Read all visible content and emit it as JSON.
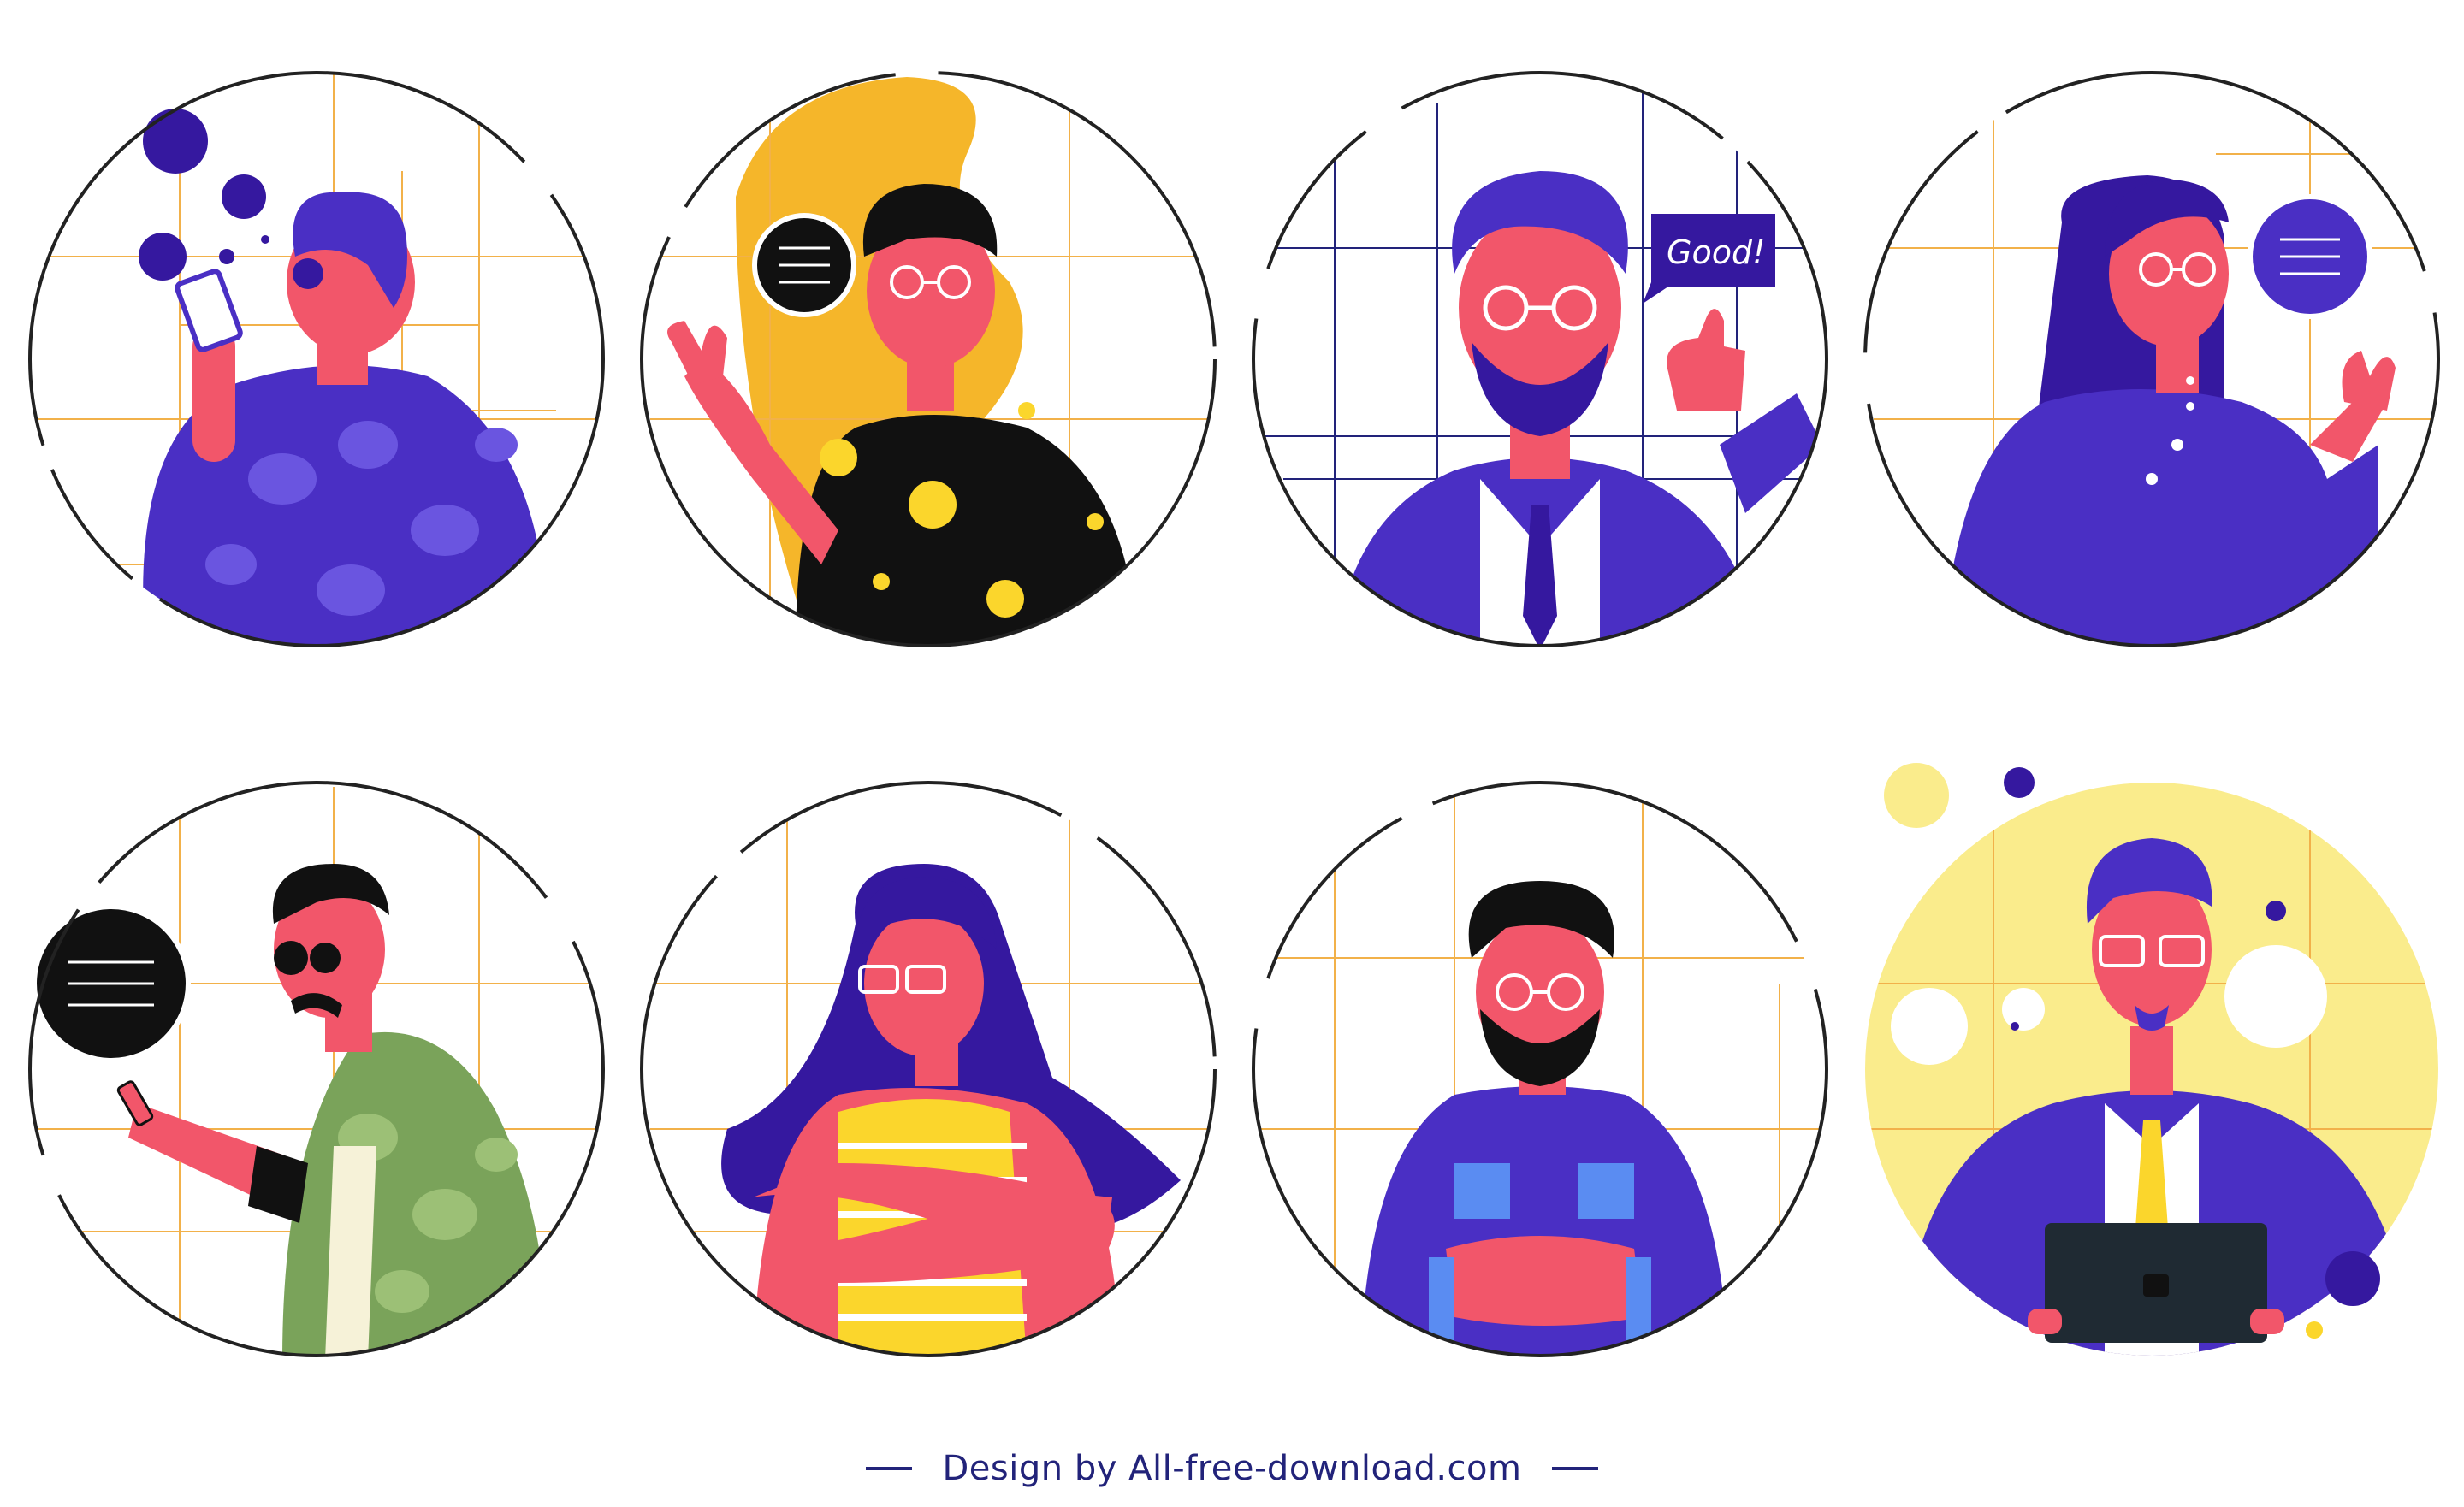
{
  "footer": {
    "credit": "Design by All-free-download.com"
  },
  "speech": {
    "good": "Good!"
  },
  "colors": {
    "purple": "#4a2fc4",
    "dark_purple": "#35189f",
    "skin": "#f2566a",
    "yellow": "#fbd62c",
    "orange": "#f5b62a",
    "black": "#111111",
    "green": "#7aa35a",
    "grid_line": "#f2b14a",
    "outline": "#222222"
  },
  "avatars": [
    {
      "id": "avatar-man-phone"
    },
    {
      "id": "avatar-man-waving"
    },
    {
      "id": "avatar-man-thumbs-up"
    },
    {
      "id": "avatar-woman-waving"
    },
    {
      "id": "avatar-man-sunglasses-phone"
    },
    {
      "id": "avatar-woman-crossed-arms"
    },
    {
      "id": "avatar-man-beard-crossed-arms"
    },
    {
      "id": "avatar-man-tablet"
    }
  ]
}
